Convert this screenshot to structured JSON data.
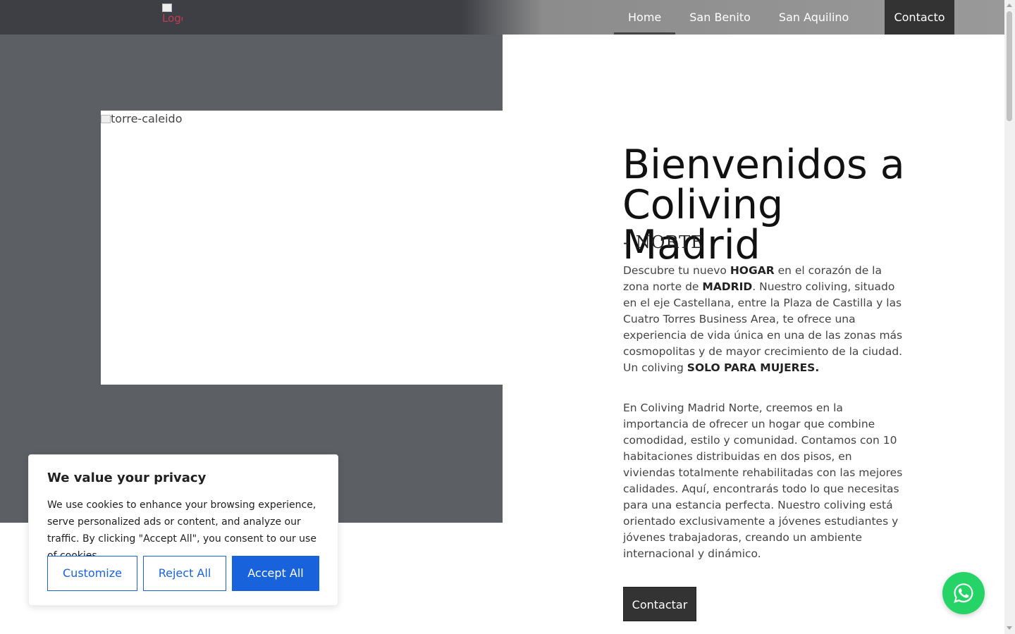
{
  "header": {
    "logo_alt": "Logo",
    "nav": [
      {
        "label": "Home"
      },
      {
        "label": "San Benito"
      },
      {
        "label": "San Aquilino"
      }
    ],
    "contact_label": "Contacto"
  },
  "hero": {
    "image_alt": "torre-caleido",
    "title": "Bienvenidos a Coliving Madrid",
    "subtitle": "- NORTE",
    "para1": {
      "t1": "Descubre tu nuevo ",
      "b1": "HOGAR",
      "t2": " en el corazón de la zona norte de ",
      "b2": "MADRID",
      "t3": ". Nuestro coliving, situado en el eje Castellana, entre la Plaza de Castilla y las Cuatro Torres Business Area, te ofrece una experiencia de vida única en una de las zonas más cosmopolitas y de mayor crecimiento de la ciudad. Un coliving ",
      "b3": "SOLO PARA MUJERES."
    },
    "para2": "En Coliving Madrid Norte, creemos en la importancia de ofrecer un hogar que combine comodidad, estilo y comunidad. Contamos con 10 habitaciones distribuidas en dos pisos, en viviendas totalmente rehabilitadas con las mejores calidades. Aquí, encontrarás todo lo que necesitas para una estancia perfecta. Nuestro coliving está orientado exclusivamente a jóvenes estudiantes y jóvenes trabajadoras, creando un ambiente internacional y dinámico.",
    "cta_label": "Contactar"
  },
  "cookie": {
    "title": "We value your privacy",
    "text": "We use cookies to enhance your browsing experience, serve personalized ads or content, and analyze our traffic. By clicking \"Accept All\", you consent to our use of cookies.",
    "customize": "Customize",
    "reject": "Reject All",
    "accept": "Accept All"
  },
  "colors": {
    "accent": "#1863dc",
    "whatsapp": "#25d366",
    "dark": "#333333"
  },
  "icons": {
    "whatsapp": "whatsapp-icon"
  }
}
